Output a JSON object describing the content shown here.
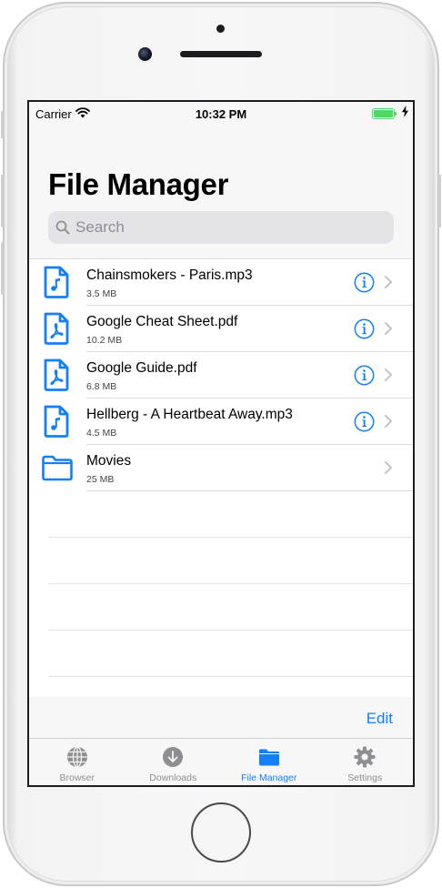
{
  "status_bar": {
    "carrier": "Carrier",
    "time": "10:32 PM"
  },
  "header": {
    "title": "File Manager"
  },
  "search": {
    "placeholder": "Search"
  },
  "files": [
    {
      "name": "Chainsmokers - Paris.mp3",
      "size": "3.5 MB",
      "icon": "music-file-icon"
    },
    {
      "name": "Google Cheat Sheet.pdf",
      "size": "10.2 MB",
      "icon": "pdf-file-icon"
    },
    {
      "name": "Google Guide.pdf",
      "size": "6.8 MB",
      "icon": "pdf-file-icon"
    },
    {
      "name": "Hellberg - A Heartbeat Away.mp3",
      "size": "4.5 MB",
      "icon": "music-file-icon"
    },
    {
      "name": "Movies",
      "size": "25 MB",
      "icon": "folder-icon"
    }
  ],
  "toolbar": {
    "edit_label": "Edit"
  },
  "tabs": [
    {
      "label": "Browser",
      "icon": "globe-icon",
      "active": false
    },
    {
      "label": "Downloads",
      "icon": "download-icon",
      "active": false
    },
    {
      "label": "File Manager",
      "icon": "folder-icon",
      "active": true
    },
    {
      "label": "Settings",
      "icon": "gear-icon",
      "active": false
    }
  ],
  "colors": {
    "accent": "#147efb",
    "inactive": "#8e8e93",
    "battery": "#4cd964"
  }
}
